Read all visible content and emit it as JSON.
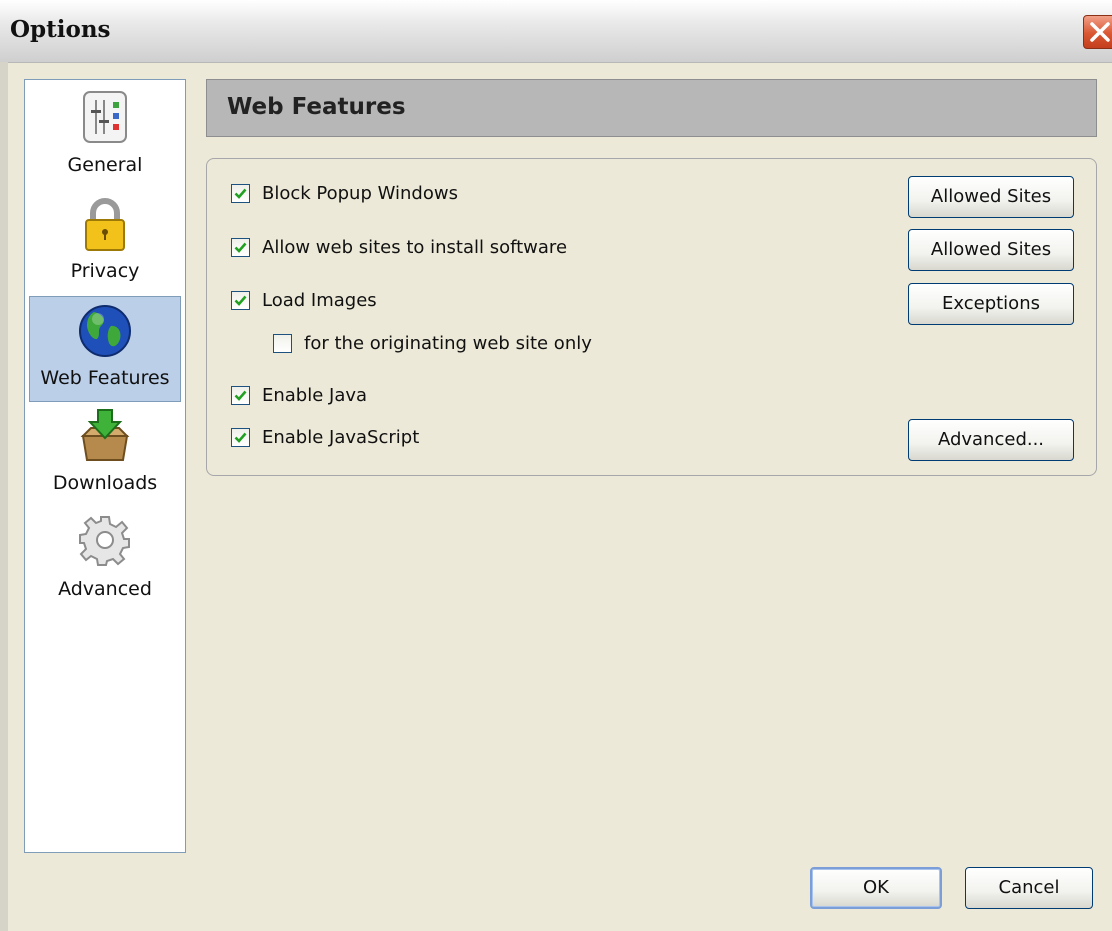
{
  "window": {
    "title": "Options"
  },
  "sidebar": {
    "items": [
      {
        "label": "General",
        "icon": "general-settings-icon",
        "selected": false
      },
      {
        "label": "Privacy",
        "icon": "padlock-icon",
        "selected": false
      },
      {
        "label": "Web Features",
        "icon": "globe-icon",
        "selected": true
      },
      {
        "label": "Downloads",
        "icon": "download-box-icon",
        "selected": false
      },
      {
        "label": "Advanced",
        "icon": "gear-icon",
        "selected": false
      }
    ]
  },
  "panel": {
    "title": "Web Features",
    "options": [
      {
        "label": "Block Popup Windows",
        "checked": true
      },
      {
        "label": "Allow web sites to install software",
        "checked": true
      },
      {
        "label": "Load Images",
        "checked": true
      },
      {
        "label": "for the originating web site only",
        "checked": false
      },
      {
        "label": "Enable Java",
        "checked": true
      },
      {
        "label": "Enable JavaScript",
        "checked": true
      }
    ],
    "buttons": {
      "popup_allowed_sites": "Allowed Sites",
      "install_allowed_sites": "Allowed Sites",
      "images_exceptions": "Exceptions",
      "javascript_advanced": "Advanced..."
    }
  },
  "footer": {
    "ok": "OK",
    "cancel": "Cancel"
  },
  "colors": {
    "accent_selected": "#bccfe8",
    "checkmark": "#21a121",
    "close": "#d95732"
  }
}
